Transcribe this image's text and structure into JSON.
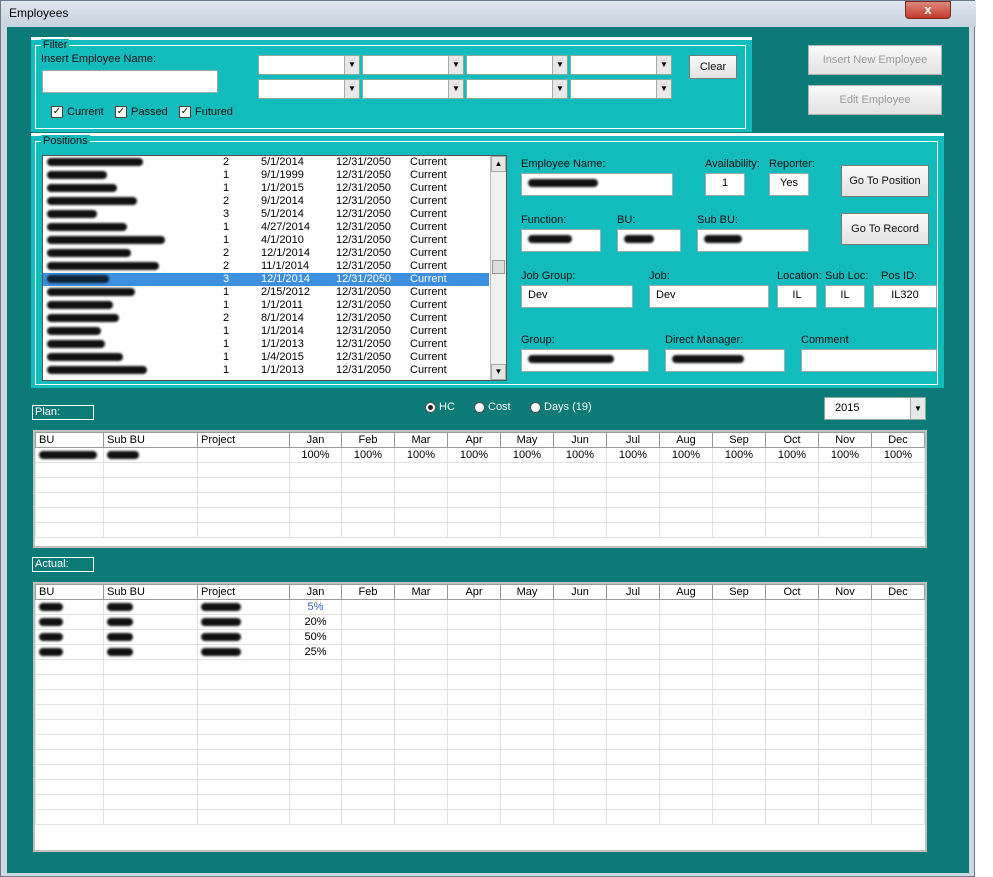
{
  "window": {
    "title": "Employees",
    "close": "x"
  },
  "filter": {
    "title": "Filter",
    "name_label": "Insert Employee Name:",
    "name_value": "",
    "clear": "Clear",
    "checks": [
      {
        "label": "Current",
        "checked": true
      },
      {
        "label": "Passed",
        "checked": true
      },
      {
        "label": "Futured",
        "checked": true
      }
    ]
  },
  "actions": {
    "insert": "Insert New Employee",
    "edit": "Edit Employee"
  },
  "positions": {
    "title": "Positions",
    "rows": [
      [
        "",
        "2",
        "5/1/2014",
        "12/31/2050",
        "Current"
      ],
      [
        "",
        "1",
        "9/1/1999",
        "12/31/2050",
        "Current"
      ],
      [
        "",
        "1",
        "1/1/2015",
        "12/31/2050",
        "Current"
      ],
      [
        "",
        "2",
        "9/1/2014",
        "12/31/2050",
        "Current"
      ],
      [
        "",
        "3",
        "5/1/2014",
        "12/31/2050",
        "Current"
      ],
      [
        "",
        "1",
        "4/27/2014",
        "12/31/2050",
        "Current"
      ],
      [
        "",
        "1",
        "4/1/2010",
        "12/31/2050",
        "Current"
      ],
      [
        "",
        "2",
        "12/1/2014",
        "12/31/2050",
        "Current"
      ],
      [
        "",
        "2",
        "11/1/2014",
        "12/31/2050",
        "Current"
      ],
      [
        "",
        "3",
        "12/1/2014",
        "12/31/2050",
        "Current"
      ],
      [
        "",
        "1",
        "2/15/2012",
        "12/31/2050",
        "Current"
      ],
      [
        "",
        "1",
        "1/1/2011",
        "12/31/2050",
        "Current"
      ],
      [
        "",
        "2",
        "8/1/2014",
        "12/31/2050",
        "Current"
      ],
      [
        "",
        "1",
        "1/1/2014",
        "12/31/2050",
        "Current"
      ],
      [
        "",
        "1",
        "1/1/2013",
        "12/31/2050",
        "Current"
      ],
      [
        "",
        "1",
        "1/4/2015",
        "12/31/2050",
        "Current"
      ],
      [
        "",
        "1",
        "1/1/2013",
        "12/31/2050",
        "Current"
      ]
    ]
  },
  "details": {
    "employee_name_label": "Employee Name:",
    "availability_label": "Availability:",
    "availability": "1",
    "reporter_label": "Reporter:",
    "reporter": "Yes",
    "function_label": "Function:",
    "bu_label": "BU:",
    "subbu_label": "Sub BU:",
    "jobgroup_label": "Job Group:",
    "jobgroup": "Dev",
    "job_label": "Job:",
    "job": "Dev",
    "location_label": "Location:",
    "location": "IL",
    "subloc_label": "Sub Loc:",
    "subloc": "IL",
    "posid_label": "Pos ID:",
    "posid": "IL320",
    "group_label": "Group:",
    "manager_label": "Direct Manager:",
    "comment_label": "Comment",
    "comment": "",
    "goto_position": "Go To Position",
    "goto_record": "Go To Record"
  },
  "mode": {
    "options": [
      {
        "label": "HC",
        "selected": true
      },
      {
        "label": "Cost",
        "selected": false
      },
      {
        "label": "Days (19)",
        "selected": false
      }
    ],
    "year": "2015"
  },
  "plan": {
    "label": "Plan:",
    "headers": [
      "BU",
      "Sub BU",
      "Project",
      "Jan",
      "Feb",
      "Mar",
      "Apr",
      "May",
      "Jun",
      "Jul",
      "Aug",
      "Sep",
      "Oct",
      "Nov",
      "Dec"
    ],
    "rows": [
      [
        "",
        "",
        "",
        "100%",
        "100%",
        "100%",
        "100%",
        "100%",
        "100%",
        "100%",
        "100%",
        "100%",
        "100%",
        "100%",
        "100%"
      ]
    ]
  },
  "actual": {
    "label": "Actual:",
    "headers": [
      "BU",
      "Sub BU",
      "Project",
      "Jan",
      "Feb",
      "Mar",
      "Apr",
      "May",
      "Jun",
      "Jul",
      "Aug",
      "Sep",
      "Oct",
      "Nov",
      "Dec"
    ],
    "rows": [
      [
        "",
        "",
        "",
        "5%",
        "",
        "",
        "",
        "",
        "",
        "",
        "",
        "",
        "",
        "",
        ""
      ],
      [
        "",
        "",
        "",
        "20%",
        "",
        "",
        "",
        "",
        "",
        "",
        "",
        "",
        "",
        "",
        ""
      ],
      [
        "",
        "",
        "",
        "50%",
        "",
        "",
        "",
        "",
        "",
        "",
        "",
        "",
        "",
        "",
        ""
      ],
      [
        "",
        "",
        "",
        "25%",
        "",
        "",
        "",
        "",
        "",
        "",
        "",
        "",
        "",
        "",
        ""
      ]
    ]
  }
}
